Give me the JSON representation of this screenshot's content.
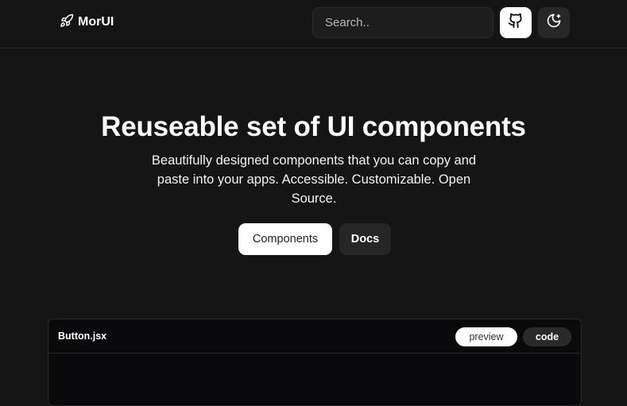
{
  "header": {
    "brand": "MorUI",
    "search_placeholder": "Search..",
    "github_icon": "github-icon",
    "theme_icon": "moon-sparkle-icon"
  },
  "hero": {
    "title": "Reuseable set of UI components",
    "subtitle": "Beautifully designed components that you can copy and paste into your apps. Accessible. Customizable. Open Source.",
    "primary_button": "Components",
    "secondary_button": "Docs"
  },
  "code_card": {
    "filename": "Button.jsx",
    "tabs": [
      "preview",
      "code"
    ]
  },
  "colors": {
    "background": "#151515",
    "accent": "#ffffff",
    "card_background": "#0a0a0c"
  }
}
